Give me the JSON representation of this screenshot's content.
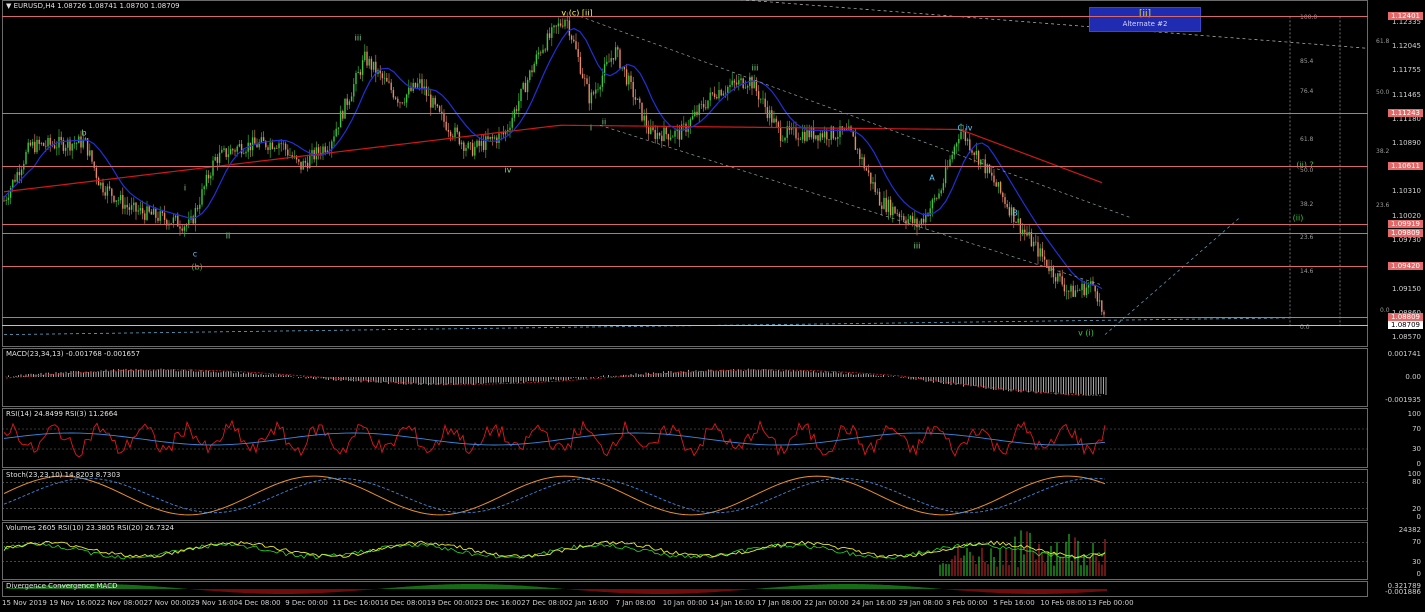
{
  "main": {
    "title": "EURUSD,H4  1.08726 1.08741 1.08700 1.08709",
    "price_ticks": [
      "1.12335",
      "1.12045",
      "1.11755",
      "1.11465",
      "1.11180",
      "1.10890",
      "1.10310",
      "1.10020",
      "1.09730",
      "1.09150",
      "1.08860",
      "1.08570"
    ],
    "hlines": [
      {
        "price": "1.12401",
        "style": "red"
      },
      {
        "price": "1.11243",
        "style": "red"
      },
      {
        "price": "1.10611",
        "style": "red"
      },
      {
        "price": "1.09919",
        "style": "red"
      },
      {
        "price": "1.09809",
        "style": "red"
      },
      {
        "price": "1.09420",
        "style": "red"
      },
      {
        "price": "1.08809",
        "style": "red"
      },
      {
        "price": "1.08709",
        "style": "white"
      }
    ],
    "alt_box": {
      "line1": "[ii]",
      "line2": "Alternate #2"
    },
    "fib_levels": [
      "100.0",
      "61.8",
      "85.4",
      "76.4",
      "50.0",
      "61.8",
      "38.2",
      "50.0",
      "38.2",
      "23.6",
      "23.6",
      "14.6",
      "0.0",
      "0.0"
    ],
    "wave_labels": [
      "v (c) [ii]",
      "iii",
      "b",
      "i",
      "ii",
      "c",
      "(b)",
      "iv",
      "i",
      "ii",
      "iii",
      "A",
      "B",
      "C  iv",
      "iii",
      "(ii) ?",
      "(ii)",
      "v  (i)"
    ]
  },
  "macd": {
    "title": "MACD(23,34,13) -0.001768 -0.001657",
    "ticks": [
      "0.001741",
      "0.00",
      "-0.001935"
    ]
  },
  "rsi": {
    "title": "RSI(14) 24.8499  RSI(3) 11.2664",
    "ticks": [
      "100",
      "70",
      "30",
      "0"
    ]
  },
  "stoch": {
    "title": "Stoch(23,23,10) 14.8203 8.7303",
    "ticks": [
      "100",
      "80",
      "20",
      "0"
    ]
  },
  "volumes": {
    "title": "Volumes 2605  RSI(10) 23.3805  RSI(20) 26.7324",
    "ticks": [
      "24382",
      "70",
      "30",
      "0"
    ]
  },
  "divergence": {
    "title": "Divergence Convergence MACD",
    "ticks": [
      "0.321789",
      "-0.001886"
    ]
  },
  "time_labels": [
    "15 Nov 2019",
    "19 Nov 16:00",
    "22 Nov 08:00",
    "27 Nov 00:00",
    "29 Nov 16:00",
    "4 Dec 08:00",
    "9 Dec 00:00",
    "11 Dec 16:00",
    "16 Dec 08:00",
    "19 Dec 00:00",
    "23 Dec 16:00",
    "27 Dec 08:00",
    "2 Jan 16:00",
    "7 Jan 08:00",
    "10 Jan 00:00",
    "14 Jan 16:00",
    "17 Jan 08:00",
    "22 Jan 00:00",
    "24 Jan 16:00",
    "29 Jan 08:00",
    "3 Feb 00:00",
    "5 Feb 16:00",
    "10 Feb 08:00",
    "13 Feb 00:00"
  ],
  "colors": {
    "up": "#3cc83c",
    "down": "#e88a6a",
    "hline": "#d66a6a",
    "ma_red": "#d01818",
    "ma_blue": "#2030d8",
    "rsi_red": "#e01818",
    "rsi_blue": "#3a8ae0",
    "stoch_orange": "#e8902a",
    "vol_yellow": "#e8e830"
  }
}
